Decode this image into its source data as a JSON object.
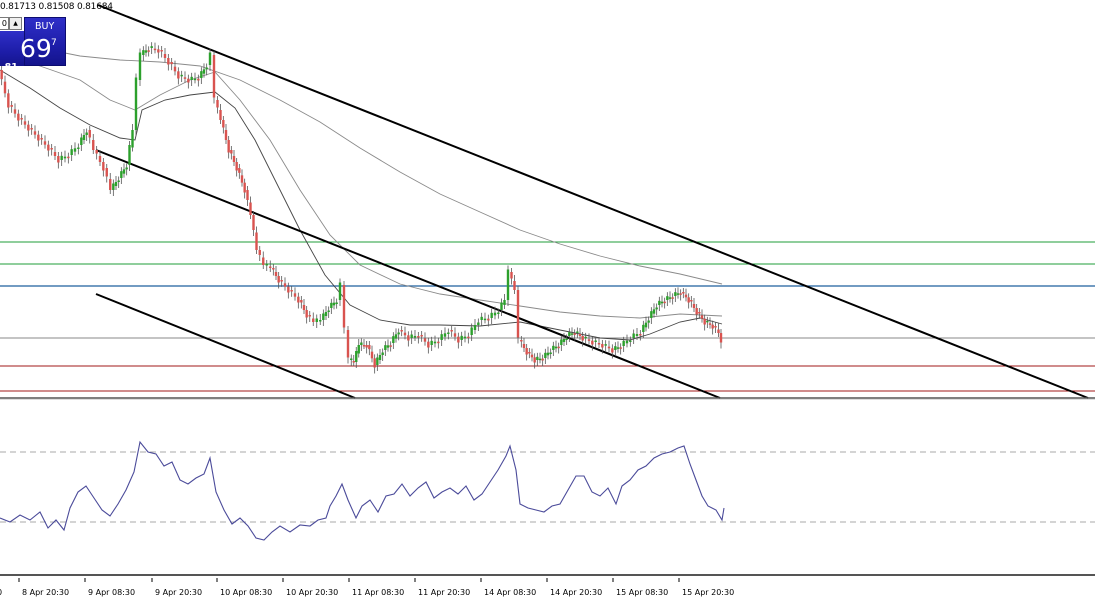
{
  "header": {
    "ohlc_text": "0.81713 0.81508 0.81684"
  },
  "trade_panel": {
    "lot_value": "0",
    "stepper_symbol": "▲",
    "buy_label": "BUY",
    "price_prefix": ".81",
    "price_big": "69",
    "price_sup": "7"
  },
  "colors": {
    "bull_candle": "#2ca02c",
    "bear_candle": "#d9534f",
    "trendline": "#000000",
    "green_level": "#1f9e3a",
    "blue_level": "#1f5f9e",
    "red_level": "#a01818",
    "gray_level": "#8a8a8a",
    "rsi_line": "#4b4b9a",
    "rsi_level": "#aaaaaa"
  },
  "time_axis": {
    "labels": [
      "8 Apr 20:30",
      "9 Apr 08:30",
      "9 Apr 20:30",
      "10 Apr 08:30",
      "10 Apr 20:30",
      "11 Apr 08:30",
      "11 Apr 20:30",
      "14 Apr 08:30",
      "14 Apr 20:30",
      "15 Apr 08:30",
      "15 Apr 20:30"
    ]
  }
}
